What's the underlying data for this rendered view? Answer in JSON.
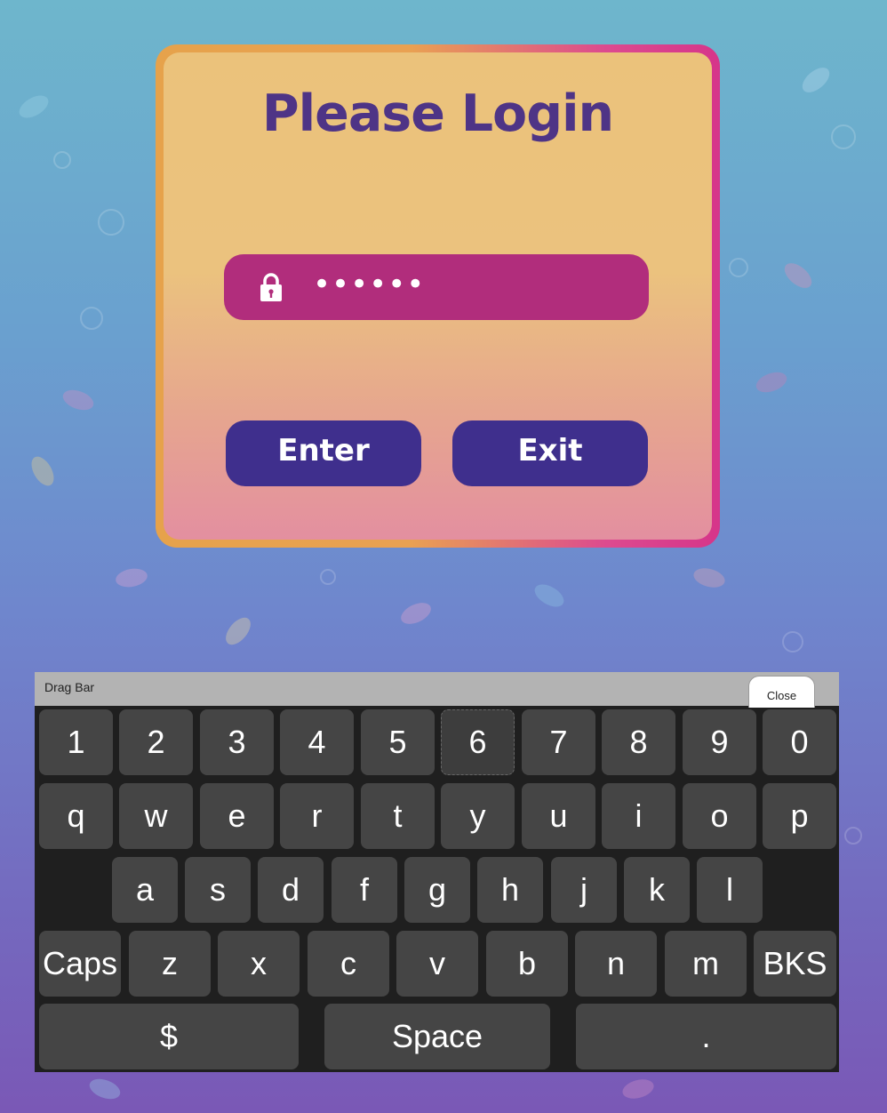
{
  "login": {
    "title": "Please Login",
    "password_value": "••••••",
    "enter_label": "Enter",
    "exit_label": "Exit"
  },
  "keyboard": {
    "drag_bar_label": "Drag Bar",
    "close_label": "Close",
    "rows": [
      [
        "1",
        "2",
        "3",
        "4",
        "5",
        "6",
        "7",
        "8",
        "9",
        "0"
      ],
      [
        "q",
        "w",
        "e",
        "r",
        "t",
        "y",
        "u",
        "i",
        "o",
        "p"
      ],
      [
        "a",
        "s",
        "d",
        "f",
        "g",
        "h",
        "j",
        "k",
        "l"
      ],
      [
        "Caps",
        "z",
        "x",
        "c",
        "v",
        "b",
        "n",
        "m",
        "BKS"
      ],
      [
        "$",
        "Space",
        "."
      ]
    ]
  },
  "colors": {
    "title": "#4e3486",
    "password_field": "#b12d7c",
    "button": "#3f2f8d",
    "key": "#454545",
    "keyboard_bg": "#1f1f1f"
  }
}
